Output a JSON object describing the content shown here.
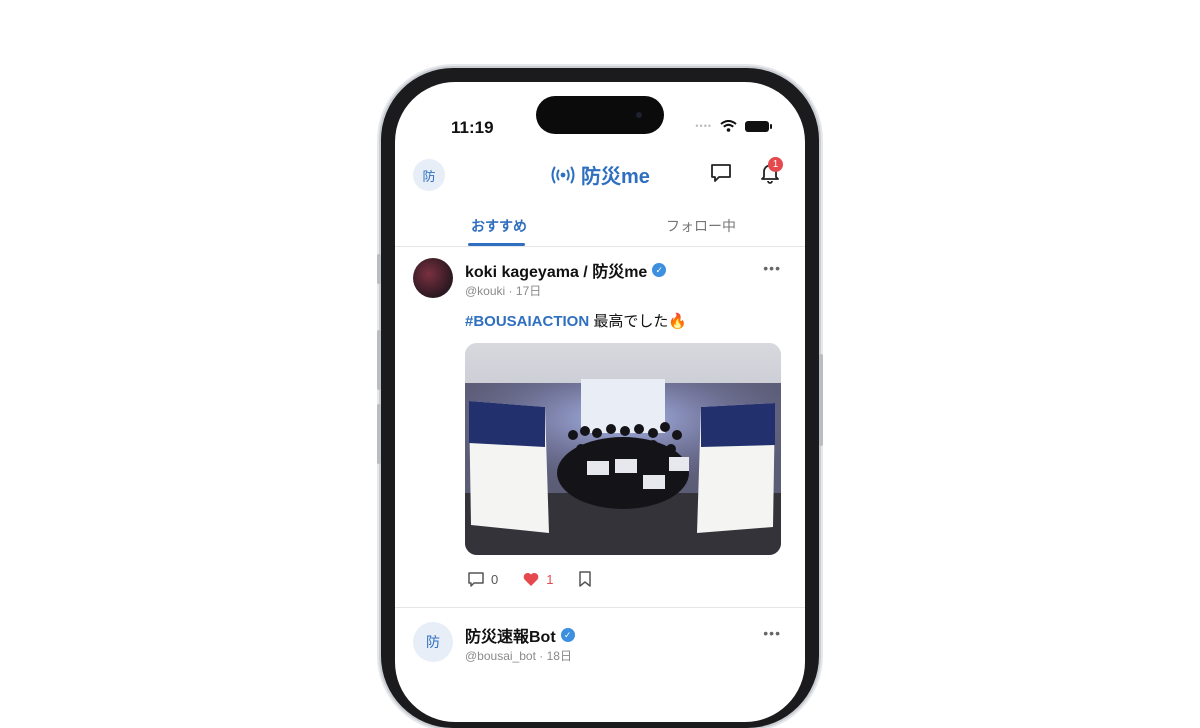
{
  "status_bar": {
    "time": "11:19",
    "signal_dots": "••••"
  },
  "header": {
    "avatar_label": "防",
    "brand_name": "防災me",
    "notification_count": "1"
  },
  "tabs": [
    {
      "label": "おすすめ",
      "active": true
    },
    {
      "label": "フォロー中",
      "active": false
    }
  ],
  "posts": [
    {
      "author": "koki kageyama / 防災me",
      "handle": "@kouki",
      "age": "17日",
      "hashtag": "#BOUSAIACTION",
      "text": " 最高でした🔥",
      "comments": "0",
      "likes": "1"
    },
    {
      "avatar_label": "防",
      "author": "防災速報Bot",
      "handle": "@bousai_bot",
      "age": "18日"
    }
  ],
  "colors": {
    "accent": "#2f6fbf",
    "verified": "#3d8fe0",
    "like": "#e5484d",
    "badge": "#e5484d"
  },
  "icons": [
    "broadcast-icon",
    "chat-icon",
    "bell-icon",
    "wifi-icon",
    "battery-icon",
    "verified-icon",
    "more-icon",
    "comment-icon",
    "heart-icon",
    "bookmark-icon"
  ]
}
